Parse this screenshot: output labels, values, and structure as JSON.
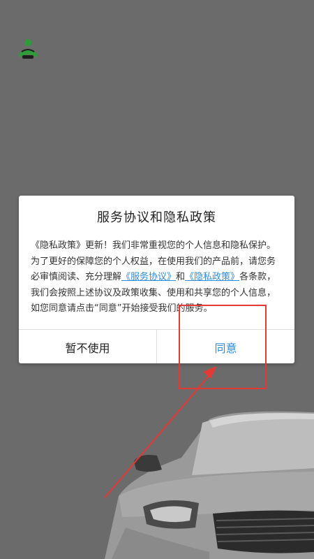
{
  "dialog": {
    "title": "服务协议和隐私政策",
    "body_intro": "《隐私政策》更新！我们非常重视您的个人信息和隐私保护。为了更好的保障您的个人权益，在使用我们的产品前，请您务必审慎阅读、充分理解",
    "service_link": "《服务协议》",
    "and_text": "和",
    "privacy_link": "《隐私政策》",
    "body_outro": "各条款，我们会按照上述协议及政策收集、使用和共享您的个人信息，如您同意请点击“同意”开始接受我们的服务。",
    "decline_label": "暂不使用",
    "agree_label": "同意"
  },
  "icons": {
    "app_logo": "app-logo-icon",
    "background": "car-illustration"
  },
  "colors": {
    "backdrop": "#6b6b6b",
    "link": "#2f8cd8",
    "annotation": "#e53935",
    "logo_green": "#2e9c3a"
  }
}
